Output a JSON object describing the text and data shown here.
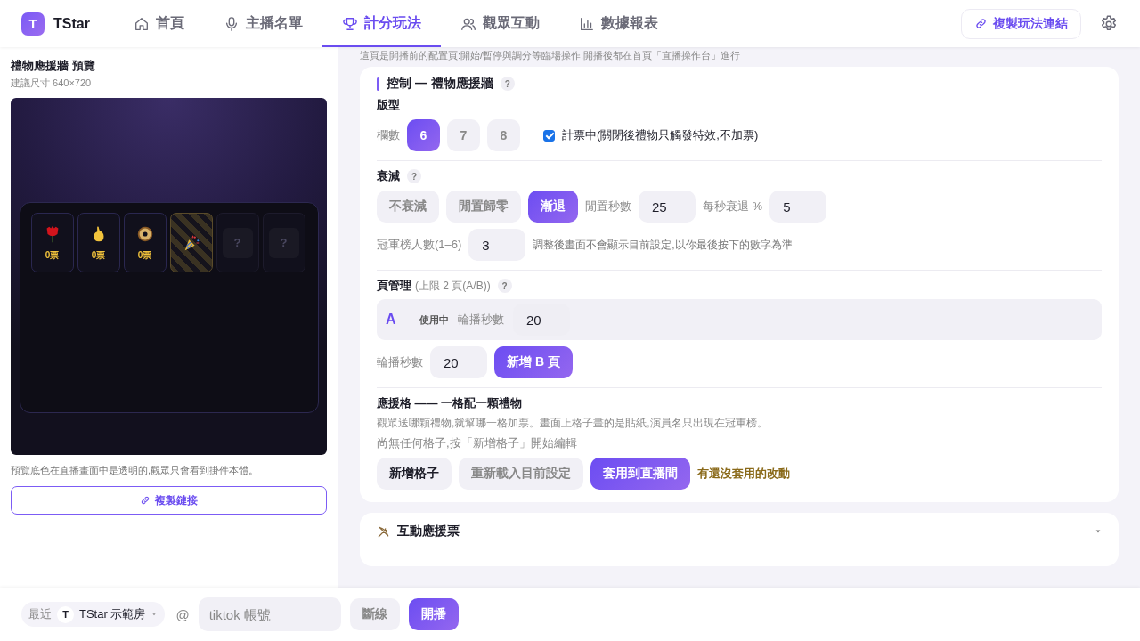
{
  "app": {
    "logo": "T",
    "name": "TStar"
  },
  "tabs": [
    {
      "label": "首頁",
      "selected": false
    },
    {
      "label": "主播名單",
      "selected": false
    },
    {
      "label": "計分玩法",
      "selected": true
    },
    {
      "label": "觀眾互動",
      "selected": false
    },
    {
      "label": "數據報表",
      "selected": false
    }
  ],
  "copy_link_button": "複製玩法連結",
  "preview": {
    "title": "禮物應援牆 預覽",
    "size": "建議尺寸 640×720",
    "tiles": [
      {
        "kind": "gift",
        "votes": "0票"
      },
      {
        "kind": "gift",
        "votes": "0票"
      },
      {
        "kind": "gift",
        "votes": "0票"
      },
      {
        "kind": "highlight"
      },
      {
        "kind": "empty",
        "mark": "?"
      },
      {
        "kind": "empty",
        "mark": "?"
      }
    ],
    "note": "預覽底色在直播畫面中是透明的,觀眾只會看到掛件本體。",
    "copy_button": "複製鏈接"
  },
  "hint": "這頁是開播前的配置頁:開始/暫停與調分等臨場操作,開播後都在首頁「直播操作台」進行",
  "control": {
    "title": "控制 — 禮物應援牆",
    "help": "?",
    "layout": {
      "heading": "版型",
      "columns_label": "欄數",
      "columns": [
        {
          "label": "6",
          "selected": true
        },
        {
          "label": "7",
          "selected": false
        },
        {
          "label": "8",
          "selected": false
        }
      ],
      "counting": {
        "label": "計票中(關閉後禮物只觸發特效,不加票)",
        "checked": true
      }
    },
    "decay": {
      "heading": "衰減",
      "help": "?",
      "modes": [
        {
          "label": "不衰減",
          "selected": false
        },
        {
          "label": "閒置歸零",
          "selected": false
        },
        {
          "label": "漸退",
          "selected": true
        }
      ],
      "idle_label": "閒置秒數",
      "idle_value": "25",
      "rate_label": "每秒衰退 %",
      "rate_value": "5",
      "top_label": "冠軍榜人數(1–6)",
      "top_value": "3",
      "top_note": "調整後畫面不會顯示目前設定,以你最後按下的數字為準"
    },
    "pages": {
      "heading": "頁管理",
      "limit": "(上限 2 頁(A/B))",
      "help": "?",
      "rows": [
        {
          "letter": "A",
          "status": "使用中",
          "rotate_label": "輪播秒數",
          "rotate_value": "20"
        }
      ],
      "rotate_label": "輪播秒數",
      "rotate_value": "20",
      "add_button": "新增 B 頁"
    },
    "grid": {
      "heading": "應援格 —— 一格配一顆禮物",
      "desc": "觀眾送哪顆禮物,就幫哪一格加票。畫面上格子畫的是貼紙,演員名只出現在冠軍榜。",
      "empty": "尚無任何格子,按「新增格子」開始編輯",
      "buttons": [
        {
          "label": "新增格子",
          "kind": "plain"
        },
        {
          "label": "重新載入目前設定",
          "kind": "muted"
        },
        {
          "label": "套用到直播間",
          "kind": "primary"
        }
      ],
      "warning": "有還沒套用的改動"
    }
  },
  "interactive_section": {
    "title": "互動應援票"
  },
  "bottom_bar": {
    "recent_label": "最近",
    "room_avatar": "T",
    "room": "TStar 示範房",
    "at": "@",
    "account_placeholder": "tiktok 帳號",
    "disconnect_button": "斷線",
    "start_button": "開播"
  }
}
